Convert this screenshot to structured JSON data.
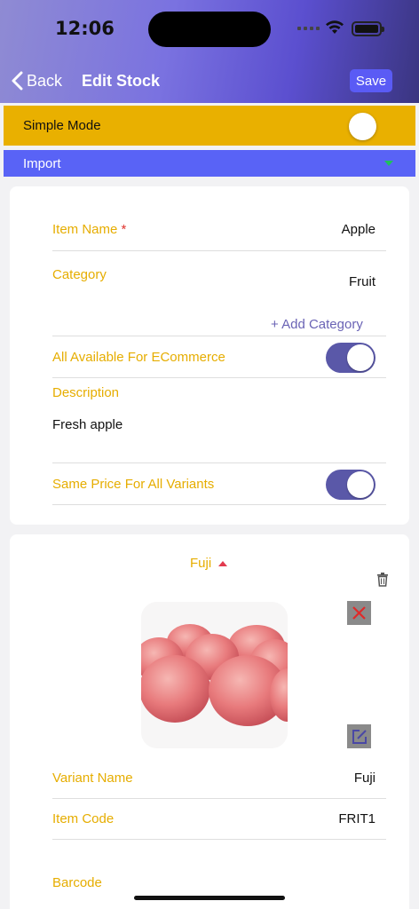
{
  "status": {
    "time": "12:06"
  },
  "nav": {
    "back_label": "Back",
    "title": "Edit Stock",
    "save_label": "Save"
  },
  "simple_mode": {
    "label": "Simple Mode",
    "enabled": false
  },
  "import": {
    "label": "Import"
  },
  "item": {
    "name_label": "Item Name",
    "required_mark": "*",
    "name_value": "Apple",
    "category_label": "Category",
    "category_value": "Fruit",
    "add_category_label": "+ Add Category",
    "ecommerce_label": "All Available For ECommerce",
    "ecommerce_enabled": true,
    "description_label": "Description",
    "description_value": "Fresh apple",
    "same_price_label": "Same Price For All Variants",
    "same_price_enabled": true
  },
  "variant": {
    "title": "Fuji",
    "name_label": "Variant Name",
    "name_value": "Fuji",
    "code_label": "Item Code",
    "code_value": "FRIT1",
    "barcode_label": "Barcode"
  },
  "colors": {
    "accent_yellow": "#e9b000",
    "import_blue": "#5963f6",
    "toggle_purple": "#5a58a8",
    "save_blue": "#5a5bf5"
  }
}
